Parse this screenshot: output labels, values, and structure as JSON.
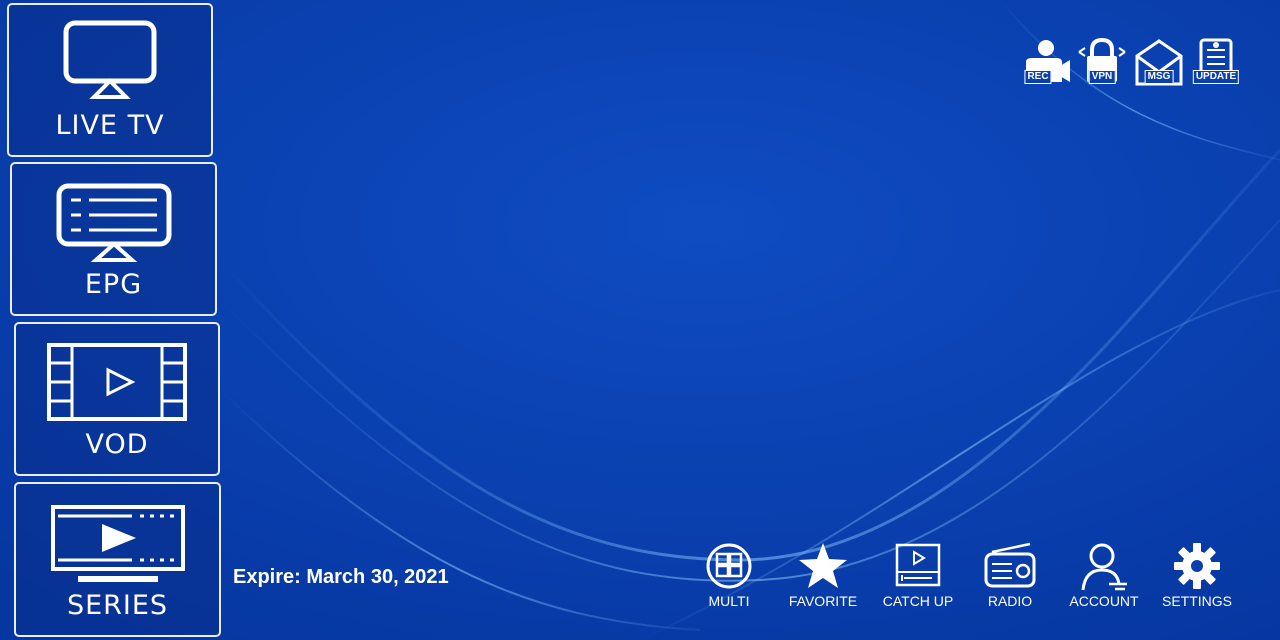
{
  "menu": {
    "live_tv": "LIVE TV",
    "epg": "EPG",
    "vod": "VOD",
    "series": "SERIES"
  },
  "expire_text": "Expire: March 30, 2021",
  "top_icons": {
    "rec": "REC",
    "vpn": "VPN",
    "msg": "MSG",
    "update": "UPDATE"
  },
  "bottom_bar": {
    "multi": "MULTI",
    "favorite": "FAVORITE",
    "catch_up": "CATCH UP",
    "radio": "RADIO",
    "account": "ACCOUNT",
    "settings": "SETTINGS"
  },
  "colors": {
    "background": "#0a3fae",
    "accent": "#ffffff"
  }
}
